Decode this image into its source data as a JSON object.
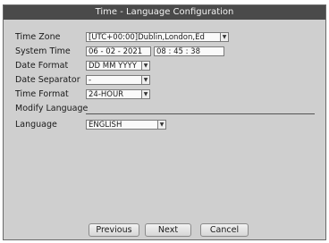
{
  "dialog": {
    "title": "Time - Language Configuration"
  },
  "form": {
    "time_zone": {
      "label": "Time Zone",
      "value": "[UTC+00:00]Dublin,London,Ed"
    },
    "system_time": {
      "label": "System Time",
      "date": "06 - 02 - 2021",
      "time": "08 : 45 : 38"
    },
    "date_format": {
      "label": "Date Format",
      "value": "DD MM YYYY"
    },
    "date_separator": {
      "label": "Date Separator",
      "value": "-"
    },
    "time_format": {
      "label": "Time Format",
      "value": "24-HOUR"
    },
    "modify_language": {
      "label": "Modify Language"
    },
    "language": {
      "label": "Language",
      "value": "ENGLISH"
    }
  },
  "buttons": {
    "previous": "Previous",
    "next": "Next",
    "cancel": "Cancel"
  },
  "icons": {
    "dropdown": "chevron-down-icon"
  }
}
